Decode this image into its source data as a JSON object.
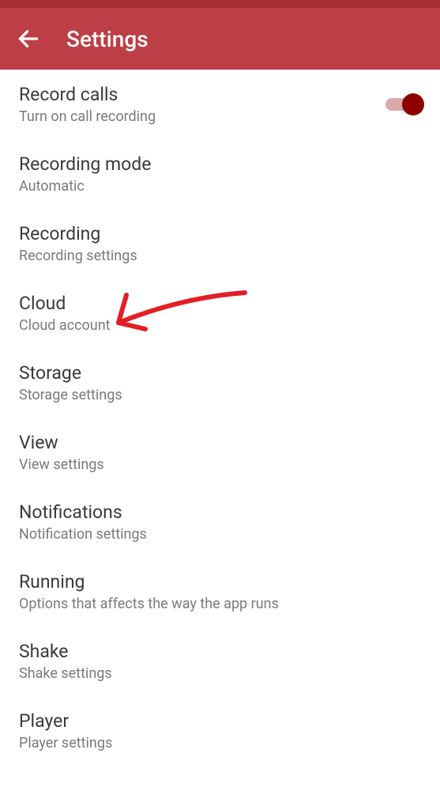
{
  "header": {
    "title": "Settings"
  },
  "settings": [
    {
      "title": "Record calls",
      "subtitle": "Turn on call recording",
      "toggle": true
    },
    {
      "title": "Recording mode",
      "subtitle": "Automatic"
    },
    {
      "title": "Recording",
      "subtitle": "Recording settings"
    },
    {
      "title": "Cloud",
      "subtitle": "Cloud account"
    },
    {
      "title": "Storage",
      "subtitle": "Storage settings"
    },
    {
      "title": "View",
      "subtitle": "View settings"
    },
    {
      "title": "Notifications",
      "subtitle": "Notification settings"
    },
    {
      "title": "Running",
      "subtitle": "Options that affects the way the app runs"
    },
    {
      "title": "Shake",
      "subtitle": "Shake settings"
    },
    {
      "title": "Player",
      "subtitle": "Player settings"
    }
  ]
}
